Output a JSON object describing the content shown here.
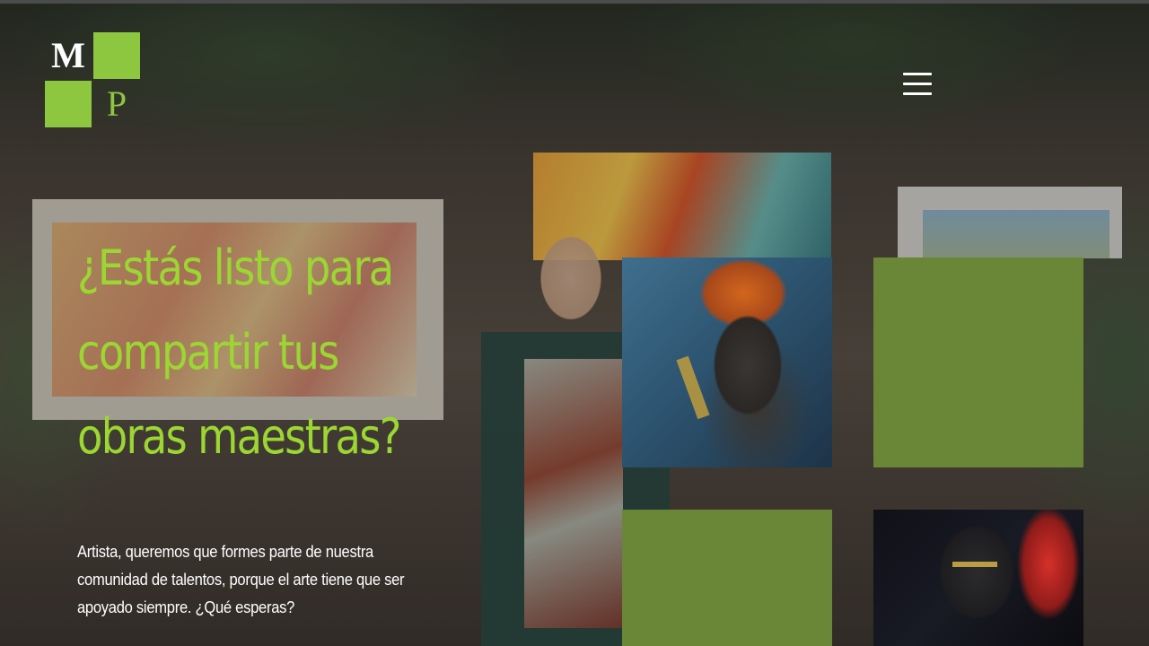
{
  "header": {
    "logo": {
      "letter_top": "M",
      "letter_bottom": "P",
      "accent_color": "#8dc63f"
    },
    "menu_icon": "hamburger-menu-icon"
  },
  "hero": {
    "headline": "¿Estás listo para compartir tus obras maestras?",
    "subtitle": "Artista, queremos que formes parte de nuestra comunidad de talentos, porque el arte tiene que ser apoyado siempre. ¿Qué esperas?",
    "headline_color": "#9bd632"
  },
  "gallery": {
    "tile_color": "#6a8637",
    "tiles": [
      {
        "kind": "image",
        "description": "portrait-gold-body-paint-1"
      },
      {
        "kind": "color"
      },
      {
        "kind": "color"
      },
      {
        "kind": "image",
        "description": "portrait-gold-body-paint-2"
      }
    ]
  }
}
